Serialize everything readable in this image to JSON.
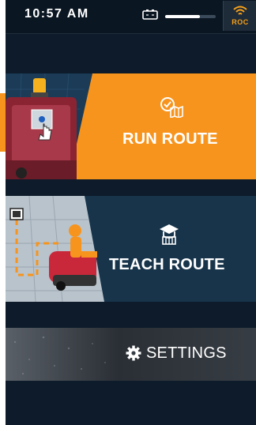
{
  "status_bar": {
    "time": "10:57 AM",
    "battery_icon": "battery-icon",
    "volume_icon": "volume-slider",
    "roc_label": "ROC",
    "roc_icon": "wifi-signal-icon",
    "accent_color": "#f7a11b"
  },
  "tiles": {
    "run_route": {
      "label": "RUN ROUTE",
      "icon": "route-check-icon",
      "color": "#f7941d"
    },
    "teach_route": {
      "label": "TEACH ROUTE",
      "icon": "teacher-icon",
      "color": "#17344a"
    },
    "settings": {
      "label": "SETTINGS",
      "icon": "gear-icon",
      "color": "#373d44"
    }
  }
}
